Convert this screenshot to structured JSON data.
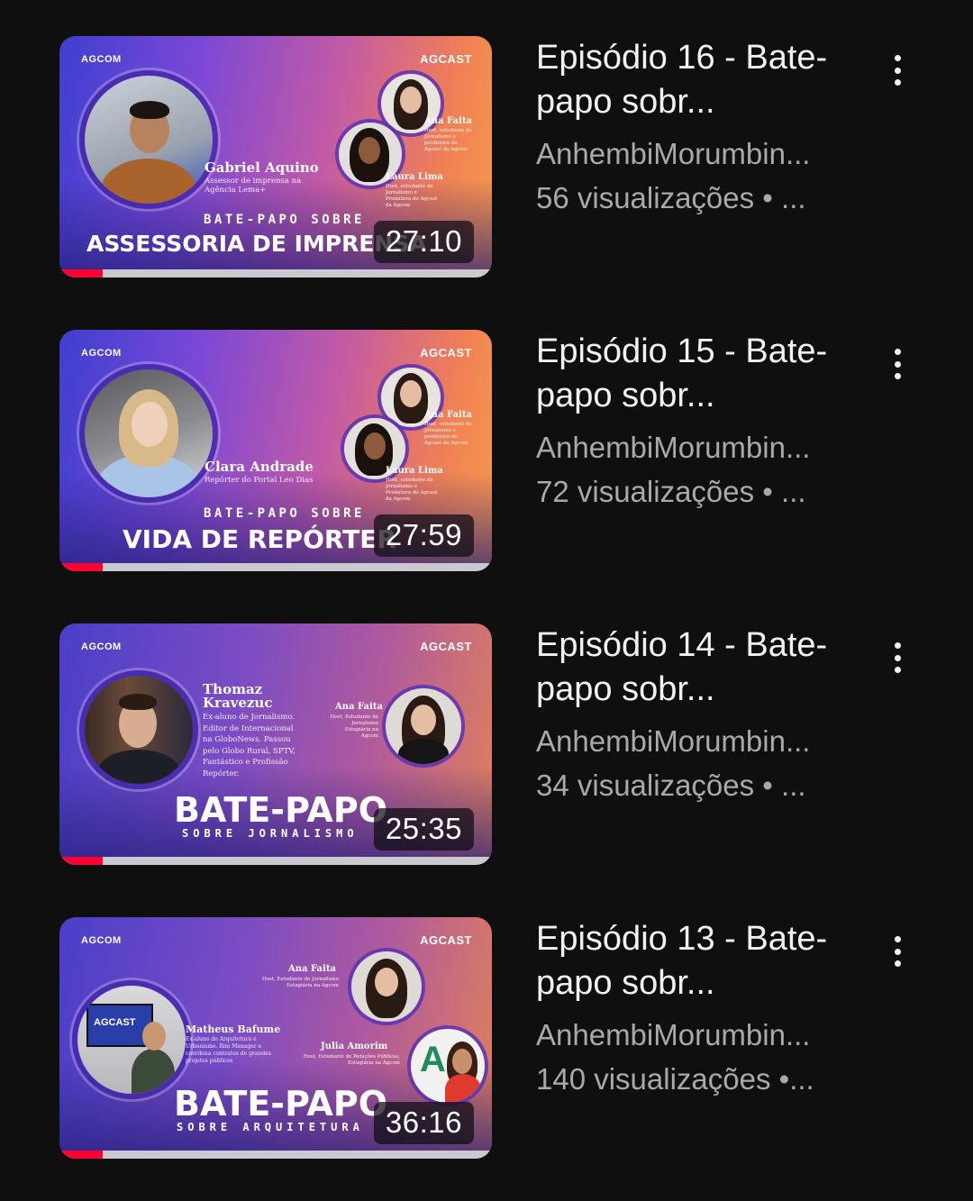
{
  "colors": {
    "background": "#0f0f0f",
    "title_text": "#f1f1f1",
    "meta_text": "#a9a9a9",
    "progress_red": "#ff0033"
  },
  "icons": {
    "more": "vertical-ellipsis-icon"
  },
  "videos": [
    {
      "title": "Episódio 16 - Bate-papo sobr...",
      "channel": "AnhembiMorumbin...",
      "views": "56 visualizações • ...",
      "duration": "27:10",
      "watched_progress": 0.1,
      "thumbnail": {
        "logo_left": "AGCOM",
        "logo_right": "AGCAST",
        "guest_name": "Gabriel Aquino",
        "guest_desc": "Assessor de imprensa na Agência Lema+",
        "host1_name": "Ana Faita",
        "host1_desc": "Host, estudante de Jornalismo e produtora do Agcast da Agcom",
        "host2_name": "Laura Lima",
        "host2_desc": "Host, estudante de Jornalismo e Produtora do Agcast da Agcom",
        "kicker": "BATE-PAPO SOBRE",
        "headline": "ASSESSORIA DE IMPRENSA"
      }
    },
    {
      "title": "Episódio 15 - Bate-papo sobr...",
      "channel": "AnhembiMorumbin...",
      "views": "72 visualizações • ...",
      "duration": "27:59",
      "watched_progress": 0.1,
      "thumbnail": {
        "logo_left": "AGCOM",
        "logo_right": "AGCAST",
        "guest_name": "Clara Andrade",
        "guest_desc": "Repórter do Portal Leo Dias",
        "host1_name": "Ana Faita",
        "host1_desc": "Host, estudante de Jornalismo e produtora do Agcast da Agcom",
        "host2_name": "Laura Lima",
        "host2_desc": "Host, estudante de Jornalismo e Produtora do Agcast da Agcom",
        "kicker": "BATE-PAPO SOBRE",
        "headline": "VIDA DE REPÓRTER"
      }
    },
    {
      "title": "Episódio 14 - Bate-papo sobr...",
      "channel": "AnhembiMorumbin...",
      "views": "34 visualizações • ...",
      "duration": "25:35",
      "watched_progress": 0.1,
      "thumbnail": {
        "logo_left": "AGCOM",
        "logo_right": "AGCAST",
        "guest_name": "Thomaz Kravezuc",
        "guest_desc": "Ex-aluno de Jornalismo. Editor de Internacional na GloboNews. Passou pelo Globo Rural, SPTV, Fantástico e Profissão Repórter.",
        "host1_name": "Ana Faita",
        "host1_desc": "Host, Estudante de Jornalismo Estagiária na Agcom",
        "headline": "BATE-PAPO",
        "subline": "SOBRE JORNALISMO"
      }
    },
    {
      "title": "Episódio 13 - Bate-papo sobr...",
      "channel": "AnhembiMorumbin...",
      "views": "140 visualizações •...",
      "duration": "36:16",
      "watched_progress": 0.1,
      "thumbnail": {
        "logo_left": "AGCOM",
        "logo_right": "AGCAST",
        "guest_name": "Matheus Bafume",
        "guest_desc": "Ex-aluno de Arquitetura e Urbanismo. Rim Manager e coordena contratos de grandes projetos públicos",
        "host1_name": "Ana Faita",
        "host1_desc": "Host, Estudante de Jornalismo Estagiária na Agcom",
        "host2_name": "Julia Amorim",
        "host2_desc": "Host, Estudante de Relações Públicas, Estagiária na Agcom",
        "screen_text": "AGCAST",
        "headline": "BATE-PAPO",
        "subline": "SOBRE ARQUITETURA"
      }
    }
  ]
}
